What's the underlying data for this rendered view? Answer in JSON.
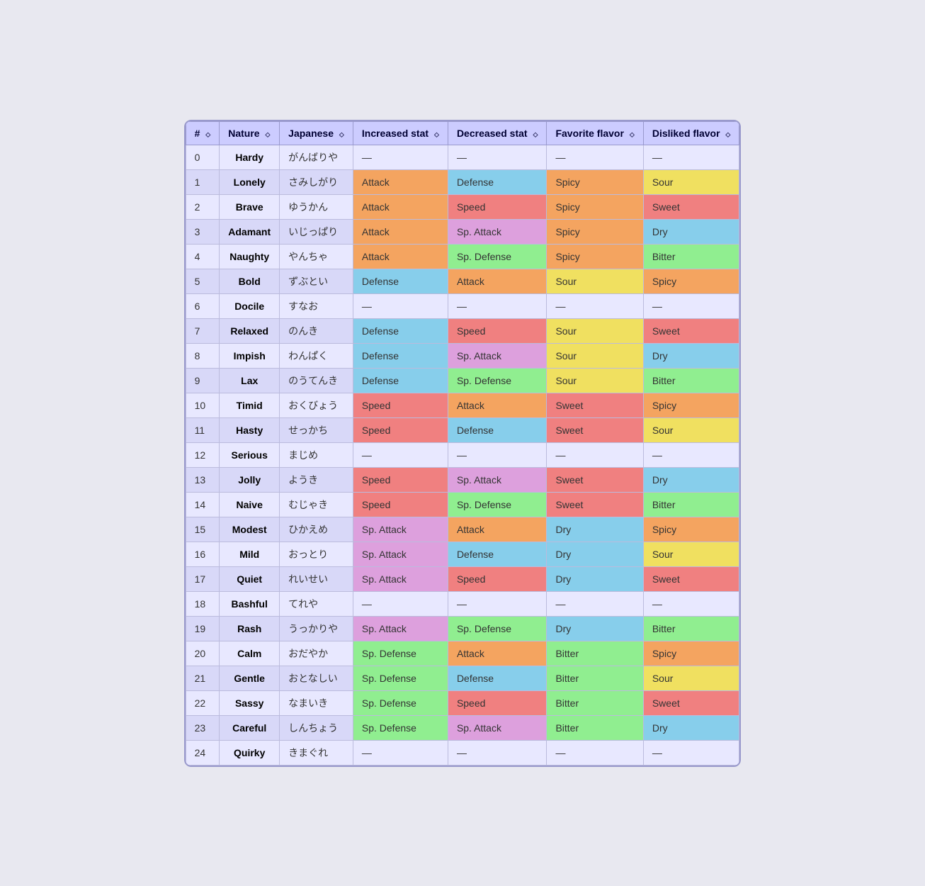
{
  "table": {
    "headers": [
      {
        "label": "#",
        "sort": true
      },
      {
        "label": "Nature",
        "sort": true
      },
      {
        "label": "Japanese",
        "sort": true
      },
      {
        "label": "Increased stat",
        "sort": true
      },
      {
        "label": "Decreased stat",
        "sort": true
      },
      {
        "label": "Favorite flavor",
        "sort": true
      },
      {
        "label": "Disliked flavor",
        "sort": true
      }
    ],
    "rows": [
      {
        "id": 0,
        "nature": "Hardy",
        "japanese": "がんばりや",
        "increased": "—",
        "decreased": "—",
        "favorite": "—",
        "disliked": "—",
        "inc_class": "",
        "dec_class": "",
        "fav_class": "",
        "dis_class": ""
      },
      {
        "id": 1,
        "nature": "Lonely",
        "japanese": "さみしがり",
        "increased": "Attack",
        "decreased": "Defense",
        "favorite": "Spicy",
        "disliked": "Sour",
        "inc_class": "attack",
        "dec_class": "defense",
        "fav_class": "spicy",
        "dis_class": "sour"
      },
      {
        "id": 2,
        "nature": "Brave",
        "japanese": "ゆうかん",
        "increased": "Attack",
        "decreased": "Speed",
        "favorite": "Spicy",
        "disliked": "Sweet",
        "inc_class": "attack",
        "dec_class": "speed",
        "fav_class": "spicy",
        "dis_class": "sweet"
      },
      {
        "id": 3,
        "nature": "Adamant",
        "japanese": "いじっぱり",
        "increased": "Attack",
        "decreased": "Sp. Attack",
        "favorite": "Spicy",
        "disliked": "Dry",
        "inc_class": "attack",
        "dec_class": "sp-attack",
        "fav_class": "spicy",
        "dis_class": "dry"
      },
      {
        "id": 4,
        "nature": "Naughty",
        "japanese": "やんちゃ",
        "increased": "Attack",
        "decreased": "Sp. Defense",
        "favorite": "Spicy",
        "disliked": "Bitter",
        "inc_class": "attack",
        "dec_class": "sp-defense",
        "fav_class": "spicy",
        "dis_class": "bitter"
      },
      {
        "id": 5,
        "nature": "Bold",
        "japanese": "ずぶとい",
        "increased": "Defense",
        "decreased": "Attack",
        "favorite": "Sour",
        "disliked": "Spicy",
        "inc_class": "defense",
        "dec_class": "attack",
        "fav_class": "sour",
        "dis_class": "spicy"
      },
      {
        "id": 6,
        "nature": "Docile",
        "japanese": "すなお",
        "increased": "—",
        "decreased": "—",
        "favorite": "—",
        "disliked": "—",
        "inc_class": "",
        "dec_class": "",
        "fav_class": "",
        "dis_class": ""
      },
      {
        "id": 7,
        "nature": "Relaxed",
        "japanese": "のんき",
        "increased": "Defense",
        "decreased": "Speed",
        "favorite": "Sour",
        "disliked": "Sweet",
        "inc_class": "defense",
        "dec_class": "speed",
        "fav_class": "sour",
        "dis_class": "sweet"
      },
      {
        "id": 8,
        "nature": "Impish",
        "japanese": "わんぱく",
        "increased": "Defense",
        "decreased": "Sp. Attack",
        "favorite": "Sour",
        "disliked": "Dry",
        "inc_class": "defense",
        "dec_class": "sp-attack",
        "fav_class": "sour",
        "dis_class": "dry"
      },
      {
        "id": 9,
        "nature": "Lax",
        "japanese": "のうてんき",
        "increased": "Defense",
        "decreased": "Sp. Defense",
        "favorite": "Sour",
        "disliked": "Bitter",
        "inc_class": "defense",
        "dec_class": "sp-defense",
        "fav_class": "sour",
        "dis_class": "bitter"
      },
      {
        "id": 10,
        "nature": "Timid",
        "japanese": "おくびょう",
        "increased": "Speed",
        "decreased": "Attack",
        "favorite": "Sweet",
        "disliked": "Spicy",
        "inc_class": "speed",
        "dec_class": "attack",
        "fav_class": "sweet",
        "dis_class": "spicy"
      },
      {
        "id": 11,
        "nature": "Hasty",
        "japanese": "せっかち",
        "increased": "Speed",
        "decreased": "Defense",
        "favorite": "Sweet",
        "disliked": "Sour",
        "inc_class": "speed",
        "dec_class": "defense",
        "fav_class": "sweet",
        "dis_class": "sour"
      },
      {
        "id": 12,
        "nature": "Serious",
        "japanese": "まじめ",
        "increased": "—",
        "decreased": "—",
        "favorite": "—",
        "disliked": "—",
        "inc_class": "",
        "dec_class": "",
        "fav_class": "",
        "dis_class": ""
      },
      {
        "id": 13,
        "nature": "Jolly",
        "japanese": "ようき",
        "increased": "Speed",
        "decreased": "Sp. Attack",
        "favorite": "Sweet",
        "disliked": "Dry",
        "inc_class": "speed",
        "dec_class": "sp-attack",
        "fav_class": "sweet",
        "dis_class": "dry"
      },
      {
        "id": 14,
        "nature": "Naive",
        "japanese": "むじゃき",
        "increased": "Speed",
        "decreased": "Sp. Defense",
        "favorite": "Sweet",
        "disliked": "Bitter",
        "inc_class": "speed",
        "dec_class": "sp-defense",
        "fav_class": "sweet",
        "dis_class": "bitter"
      },
      {
        "id": 15,
        "nature": "Modest",
        "japanese": "ひかえめ",
        "increased": "Sp. Attack",
        "decreased": "Attack",
        "favorite": "Dry",
        "disliked": "Spicy",
        "inc_class": "sp-attack",
        "dec_class": "attack",
        "fav_class": "dry",
        "dis_class": "spicy"
      },
      {
        "id": 16,
        "nature": "Mild",
        "japanese": "おっとり",
        "increased": "Sp. Attack",
        "decreased": "Defense",
        "favorite": "Dry",
        "disliked": "Sour",
        "inc_class": "sp-attack",
        "dec_class": "defense",
        "fav_class": "dry",
        "dis_class": "sour"
      },
      {
        "id": 17,
        "nature": "Quiet",
        "japanese": "れいせい",
        "increased": "Sp. Attack",
        "decreased": "Speed",
        "favorite": "Dry",
        "disliked": "Sweet",
        "inc_class": "sp-attack",
        "dec_class": "speed",
        "fav_class": "dry",
        "dis_class": "sweet"
      },
      {
        "id": 18,
        "nature": "Bashful",
        "japanese": "てれや",
        "increased": "—",
        "decreased": "—",
        "favorite": "—",
        "disliked": "—",
        "inc_class": "",
        "dec_class": "",
        "fav_class": "",
        "dis_class": ""
      },
      {
        "id": 19,
        "nature": "Rash",
        "japanese": "うっかりや",
        "increased": "Sp. Attack",
        "decreased": "Sp. Defense",
        "favorite": "Dry",
        "disliked": "Bitter",
        "inc_class": "sp-attack",
        "dec_class": "sp-defense",
        "fav_class": "dry",
        "dis_class": "bitter"
      },
      {
        "id": 20,
        "nature": "Calm",
        "japanese": "おだやか",
        "increased": "Sp. Defense",
        "decreased": "Attack",
        "favorite": "Bitter",
        "disliked": "Spicy",
        "inc_class": "sp-defense",
        "dec_class": "attack",
        "fav_class": "bitter",
        "dis_class": "spicy"
      },
      {
        "id": 21,
        "nature": "Gentle",
        "japanese": "おとなしい",
        "increased": "Sp. Defense",
        "decreased": "Defense",
        "favorite": "Bitter",
        "disliked": "Sour",
        "inc_class": "sp-defense",
        "dec_class": "defense",
        "fav_class": "bitter",
        "dis_class": "sour"
      },
      {
        "id": 22,
        "nature": "Sassy",
        "japanese": "なまいき",
        "increased": "Sp. Defense",
        "decreased": "Speed",
        "favorite": "Bitter",
        "disliked": "Sweet",
        "inc_class": "sp-defense",
        "dec_class": "speed",
        "fav_class": "bitter",
        "dis_class": "sweet"
      },
      {
        "id": 23,
        "nature": "Careful",
        "japanese": "しんちょう",
        "increased": "Sp. Defense",
        "decreased": "Sp. Attack",
        "favorite": "Bitter",
        "disliked": "Dry",
        "inc_class": "sp-defense",
        "dec_class": "sp-attack",
        "fav_class": "bitter",
        "dis_class": "dry"
      },
      {
        "id": 24,
        "nature": "Quirky",
        "japanese": "きまぐれ",
        "increased": "—",
        "decreased": "—",
        "favorite": "—",
        "disliked": "—",
        "inc_class": "",
        "dec_class": "",
        "fav_class": "",
        "dis_class": ""
      }
    ]
  }
}
